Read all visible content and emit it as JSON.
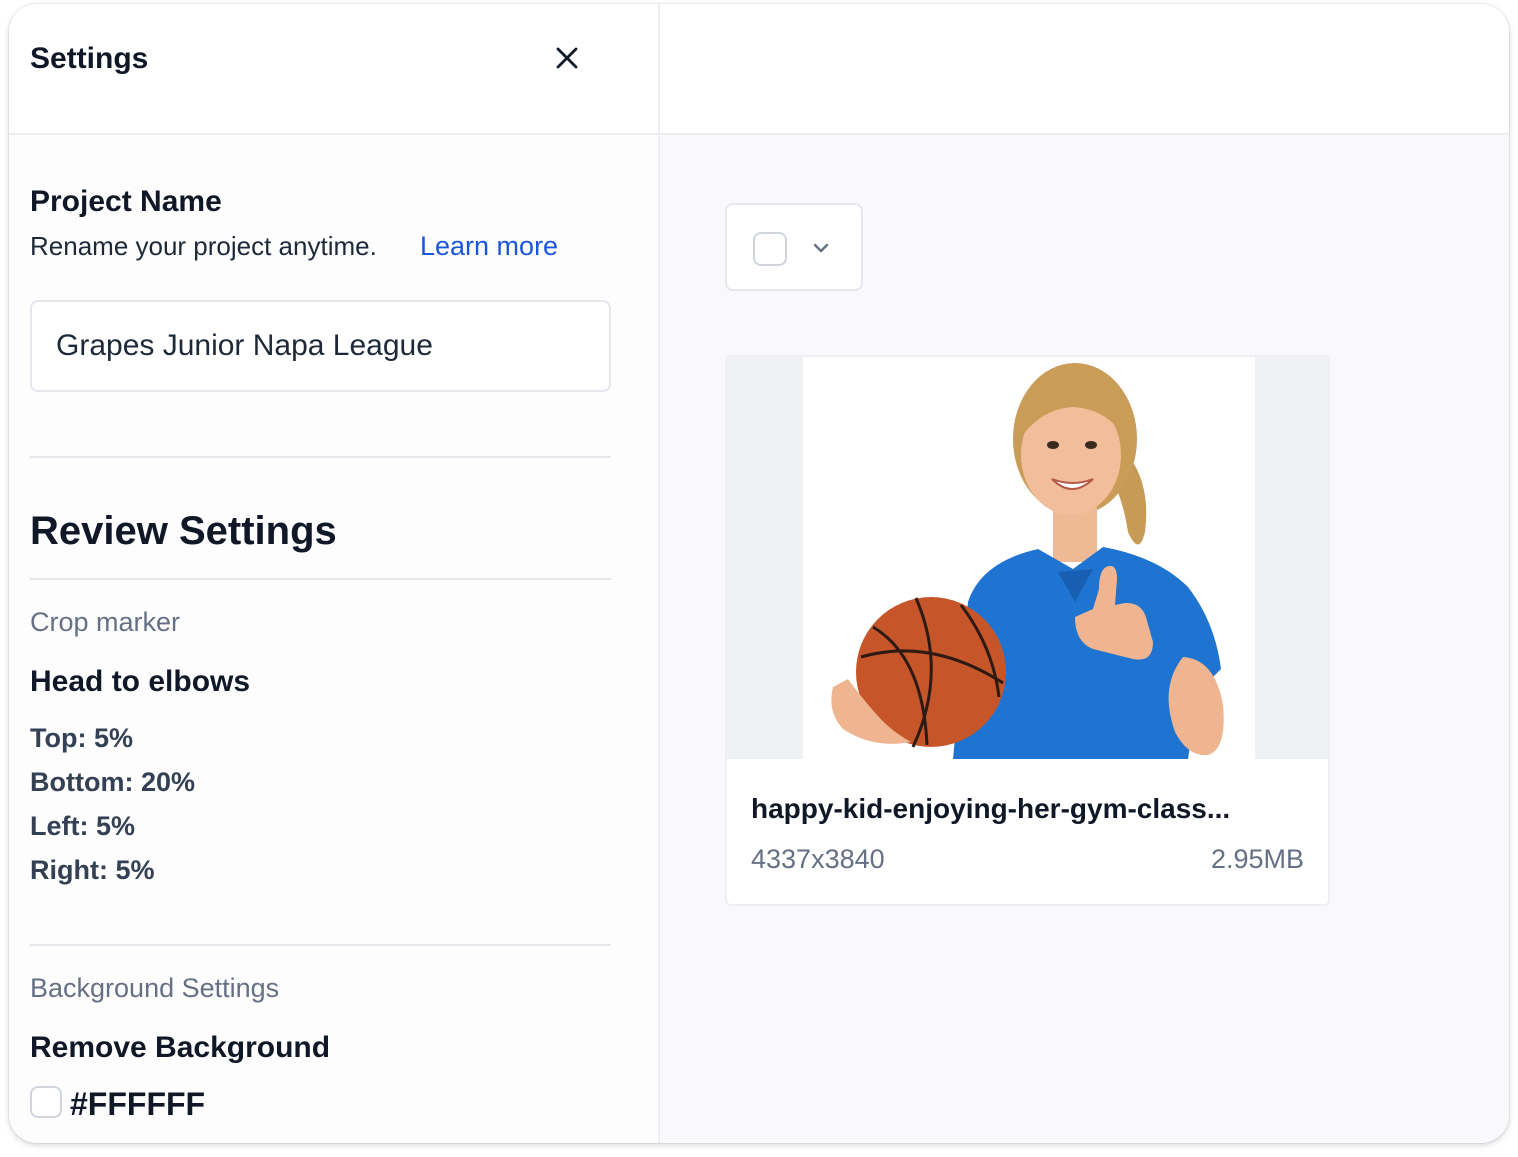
{
  "header": {
    "title": "Settings",
    "close_icon": "close-icon"
  },
  "project": {
    "title": "Project Name",
    "description": "Rename your project anytime.",
    "learn_more": "Learn more",
    "name_value": "Grapes Junior Napa League"
  },
  "review": {
    "title": "Review Settings",
    "crop_label": "Crop marker",
    "crop_value": "Head to elbows",
    "crop_lines": [
      "Top: 5%",
      "Bottom: 20%",
      "Left: 5%",
      "Right: 5%"
    ],
    "background_label": "Background Settings",
    "background_value": "Remove Background",
    "background_color": "#FFFFFF",
    "background_checked": false
  },
  "preview": {
    "select_all_checked": false,
    "select_icon": "chevron-down-icon",
    "image": {
      "file_name": "happy-kid-enjoying-her-gym-class...",
      "dimensions": "4337x3840",
      "size": "2.95MB"
    }
  },
  "colors": {
    "link": "#1a56db",
    "shirt": "#1f73d1",
    "ball": "#c6562a",
    "text": "#101828",
    "muted": "#667085"
  }
}
